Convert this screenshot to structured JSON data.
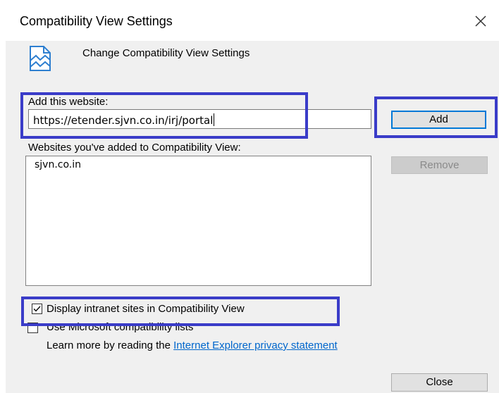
{
  "window": {
    "title": "Compatibility View Settings",
    "close_glyph": "close-icon"
  },
  "header": {
    "icon": "compatibility-view-icon",
    "text": "Change Compatibility View Settings"
  },
  "add_section": {
    "label": "Add this website:",
    "input_value": "https://etender.sjvn.co.in/irj/portal",
    "add_button": "Add"
  },
  "list_section": {
    "label": "Websites you've added to Compatibility View:",
    "items": [
      "sjvn.co.in"
    ],
    "remove_button": "Remove"
  },
  "options": {
    "intranet": {
      "label": "Display intranet sites in Compatibility View",
      "checked": true
    },
    "ms_lists": {
      "label": "Use Microsoft compatibility lists",
      "checked": false
    }
  },
  "learn_more": {
    "prefix": "Learn more by reading the ",
    "link_text": "Internet Explorer privacy statement"
  },
  "footer": {
    "close_button": "Close"
  },
  "colors": {
    "highlight": "#3a3cc8",
    "link": "#0066cc",
    "accent": "#0078d7"
  }
}
